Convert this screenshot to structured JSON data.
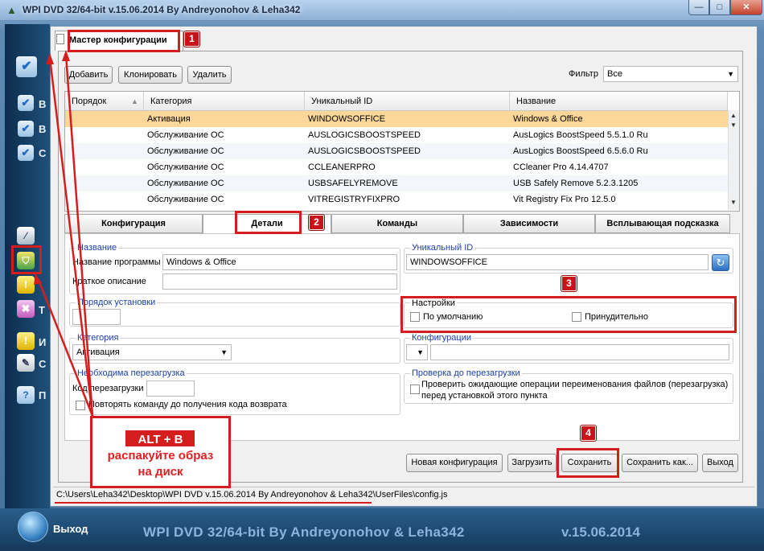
{
  "window": {
    "title": "WPI DVD 32/64-bit v.15.06.2014 By Andreyonohov & Leha342",
    "minimize_glyph": "—",
    "maximize_glyph": "□",
    "close_glyph": "✕"
  },
  "sidebar": {
    "letters": [
      "В",
      "В",
      "С",
      "Т",
      "И",
      "С",
      "П"
    ]
  },
  "dialog": {
    "tab_label": "Мастер конфигурации",
    "toolbar": {
      "add_label": "Добавить",
      "clone_label": "Клонировать",
      "delete_label": "Удалить",
      "filter_label": "Фильтр",
      "filter_value": "Все"
    },
    "grid": {
      "columns": [
        "Порядок",
        "Категория",
        "Уникальный ID",
        "Название"
      ],
      "rows": [
        {
          "order": "",
          "category": "Активация",
          "id": "WINDOWSOFFICE",
          "name": "Windows & Office"
        },
        {
          "order": "",
          "category": "Обслуживание ОС",
          "id": "AUSLOGICSBOOSTSPEED",
          "name": "AusLogics BoostSpeed 5.5.1.0 Ru"
        },
        {
          "order": "",
          "category": "Обслуживание ОС",
          "id": "AUSLOGICSBOOSTSPEED",
          "name": "AusLogics BoostSpeed 6.5.6.0 Ru"
        },
        {
          "order": "",
          "category": "Обслуживание ОС",
          "id": "CCLEANERPRO",
          "name": "CCleaner Pro 4.14.4707"
        },
        {
          "order": "",
          "category": "Обслуживание ОС",
          "id": "USBSAFELYREMOVE",
          "name": "USB Safely Remove 5.2.3.1205"
        },
        {
          "order": "",
          "category": "Обслуживание ОС",
          "id": "VITREGISTRYFIXPRO",
          "name": "Vit Registry Fix Pro 12.5.0"
        }
      ],
      "selected_row": 0
    },
    "subtabs": [
      "Конфигурация",
      "Детали",
      "Команды",
      "Зависимости",
      "Всплывающая подсказка"
    ],
    "details": {
      "name_group": "Название",
      "program_name_label": "Название программы",
      "program_name_value": "Windows & Office",
      "short_desc_label": "Краткое описание",
      "short_desc_value": "",
      "unique_id_group": "Уникальный ID",
      "unique_id_value": "WINDOWSOFFICE",
      "install_order_group": "Порядок установки",
      "settings_group": "Настройки",
      "default_label": "По умолчанию",
      "forced_label": "Принудительно",
      "category_group": "Категория",
      "category_value": "Активация",
      "configs_group": "Конфигурации",
      "reboot_group": "Необходима перезагрузка",
      "reboot_code_label": "Код перезагрузки",
      "repeat_label": "Повторять команду до получения кода возврата",
      "check_group": "Проверка до перезагрузки",
      "check_label_1": "Проверить ожидающие операции переименования файлов (перезагрузка)",
      "check_label_2": "перед установкой этого пункта"
    },
    "buttons": {
      "new_config": "Новая конфигурация",
      "load": "Загрузить",
      "save": "Сохранить",
      "save_as": "Сохранить как...",
      "exit": "Выход"
    },
    "status_path": "C:\\Users\\Leha342\\Desktop\\WPI DVD v.15.06.2014 By Andreyonohov & Leha342\\UserFiles\\config.js"
  },
  "annotations": {
    "badges": [
      "1",
      "2",
      "3",
      "4"
    ],
    "callout_line_1": "ALT + B",
    "callout_line_2": "распакуйте образ",
    "callout_line_3": "на диск"
  },
  "bottom": {
    "exit_label": "Выход",
    "brand": "WPI DVD 32/64-bit By Andreyonohov & Leha342",
    "version": "v.15.06.2014"
  },
  "colors": {
    "accent_red": "#d41e1e",
    "selected_row": "#fbd89a",
    "frame_blue": "#47719d"
  }
}
